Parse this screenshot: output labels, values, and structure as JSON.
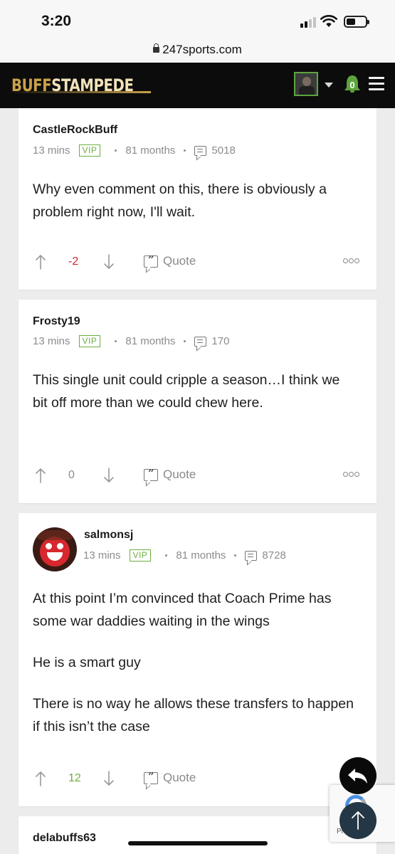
{
  "status": {
    "time": "3:20"
  },
  "browser": {
    "url": "247sports.com"
  },
  "site": {
    "logo_buff": "BUFF",
    "logo_stampede": "STAMPEDE",
    "notifications": "0"
  },
  "posts": [
    {
      "user": "CastleRockBuff",
      "time": "13 mins",
      "badge": "VIP",
      "tenure": "81 months",
      "post_count": "5018",
      "paragraphs": [
        "Why even comment on this, there is obviously a problem right now, I'll wait."
      ],
      "score": "-2",
      "score_color": "#c8282e",
      "quote_label": "Quote"
    },
    {
      "user": "Frosty19",
      "time": "13 mins",
      "badge": "VIP",
      "tenure": "81 months",
      "post_count": "170",
      "paragraphs": [
        "This single unit could cripple a season…I think we bit off more than we could chew here."
      ],
      "score": "0",
      "score_color": "#8c8c8c",
      "quote_label": "Quote"
    },
    {
      "user": "salmonsj",
      "time": "13 mins",
      "badge": "VIP",
      "tenure": "81 months",
      "post_count": "8728",
      "paragraphs": [
        "At this point I’m convinced that Coach Prime has some war daddies waiting in the wings",
        "He is a smart guy",
        "There is no way he allows these transfers to happen if this isn’t the case"
      ],
      "score": "12",
      "score_color": "#6cae3f",
      "quote_label": "Quote"
    },
    {
      "user": "delabuffs63"
    }
  ],
  "recaptcha": {
    "text": "Privacy - Terms",
    "text_visible": "Pr          erms"
  },
  "colors": {
    "header_bg": "#0c0c0c",
    "vip_green": "#6cae3f",
    "logo_gold": "#c9a24a",
    "bell_green": "#5da43c"
  }
}
